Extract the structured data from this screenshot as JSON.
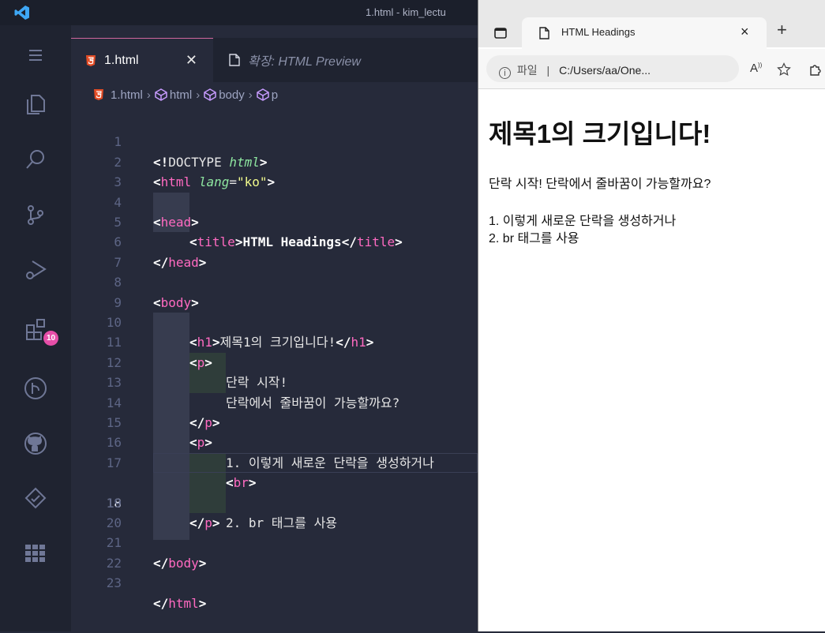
{
  "window": {
    "title": "1.html - kim_lectu"
  },
  "activity_bar": {
    "extensions_badge": "10"
  },
  "tabs": [
    {
      "label": "1.html",
      "close": "✕"
    },
    {
      "label": "확장: HTML Preview"
    }
  ],
  "breadcrumb": [
    "1.html",
    "html",
    "body",
    "p"
  ],
  "editor": {
    "current_line": 18,
    "line_numbers": [
      "1",
      "2",
      "3",
      "4",
      "5",
      "6",
      "7",
      "8",
      "9",
      "10",
      "11",
      "12",
      "13",
      "14",
      "15",
      "16",
      "17",
      "18",
      "19",
      "20",
      "21",
      "22",
      "23"
    ]
  },
  "browser": {
    "tab_title": "HTML Headings",
    "tab_close": "×",
    "new_tab": "+",
    "info_label": "파일",
    "url": "C:/Users/aa/One...",
    "read_aloud": "A",
    "h1": "제목1의 크기입니다!",
    "p1": "단락 시작! 단락에서 줄바꿈이 가능할까요?",
    "p2_line1": "1. 이렇게 새로운 단락을 생성하거나",
    "p2_line2": "2. br 태그를 사용"
  },
  "colors": {
    "editor_bg": "#262a3a",
    "tag": "#ff6ac1",
    "attribute": "#8ee6a0",
    "string": "#f1fa8c",
    "line_number": "#5d6585",
    "badge": "#e64ea8"
  }
}
